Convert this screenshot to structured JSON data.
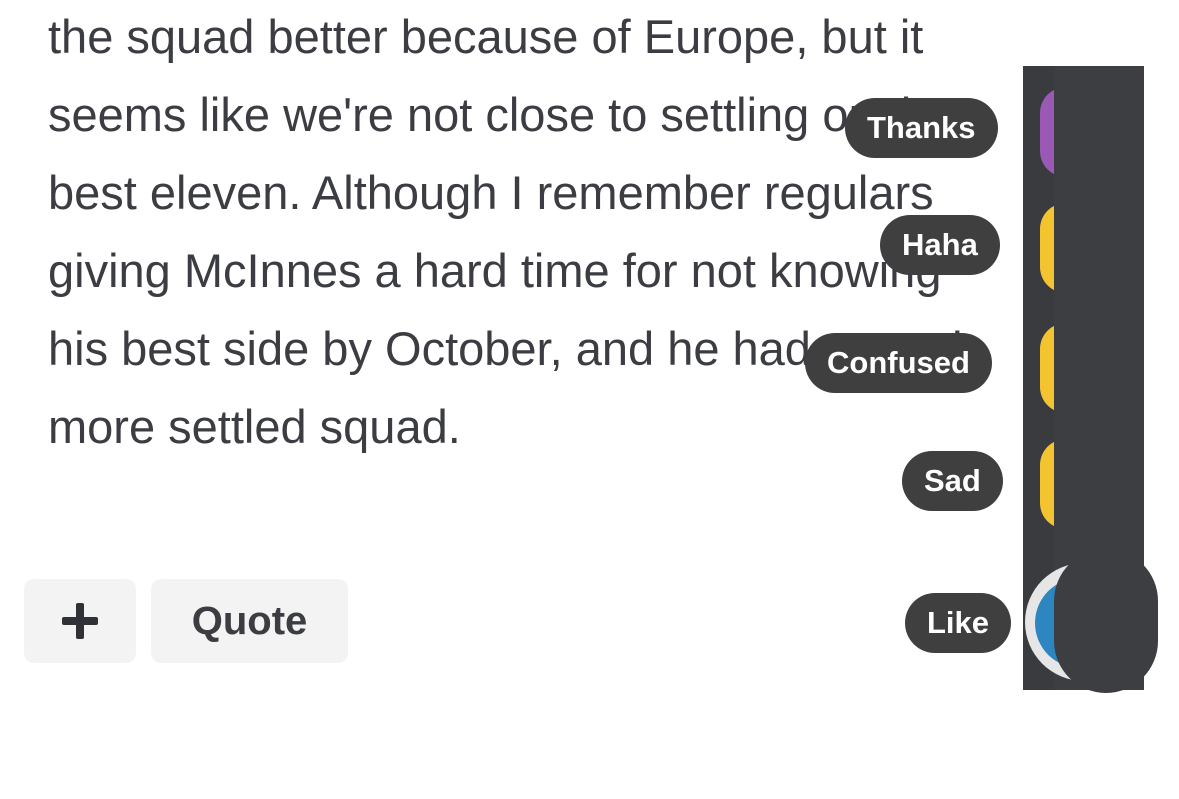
{
  "post": {
    "lines": [
      "the squad better because of Europe, but it",
      "seems like we're not close to settling on the",
      "best eleven. Although I remember regulars",
      "giving McInnes a hard time for not knowing",
      "his best side by October, and he had a much",
      "more settled squad."
    ]
  },
  "actions": {
    "plus_icon": "plus-icon",
    "quote_label": "Quote"
  },
  "reactions": [
    {
      "label": "Thanks",
      "icon": "thanks-icon",
      "color": "#9b59b6"
    },
    {
      "label": "Haha",
      "icon": "haha-icon",
      "color": "#f4c430"
    },
    {
      "label": "Confused",
      "icon": "confused-icon",
      "color": "#f4c430"
    },
    {
      "label": "Sad",
      "icon": "sad-icon",
      "color": "#f4c430"
    },
    {
      "label": "Like",
      "icon": "like-icon",
      "color": "#2e86c1"
    }
  ]
}
